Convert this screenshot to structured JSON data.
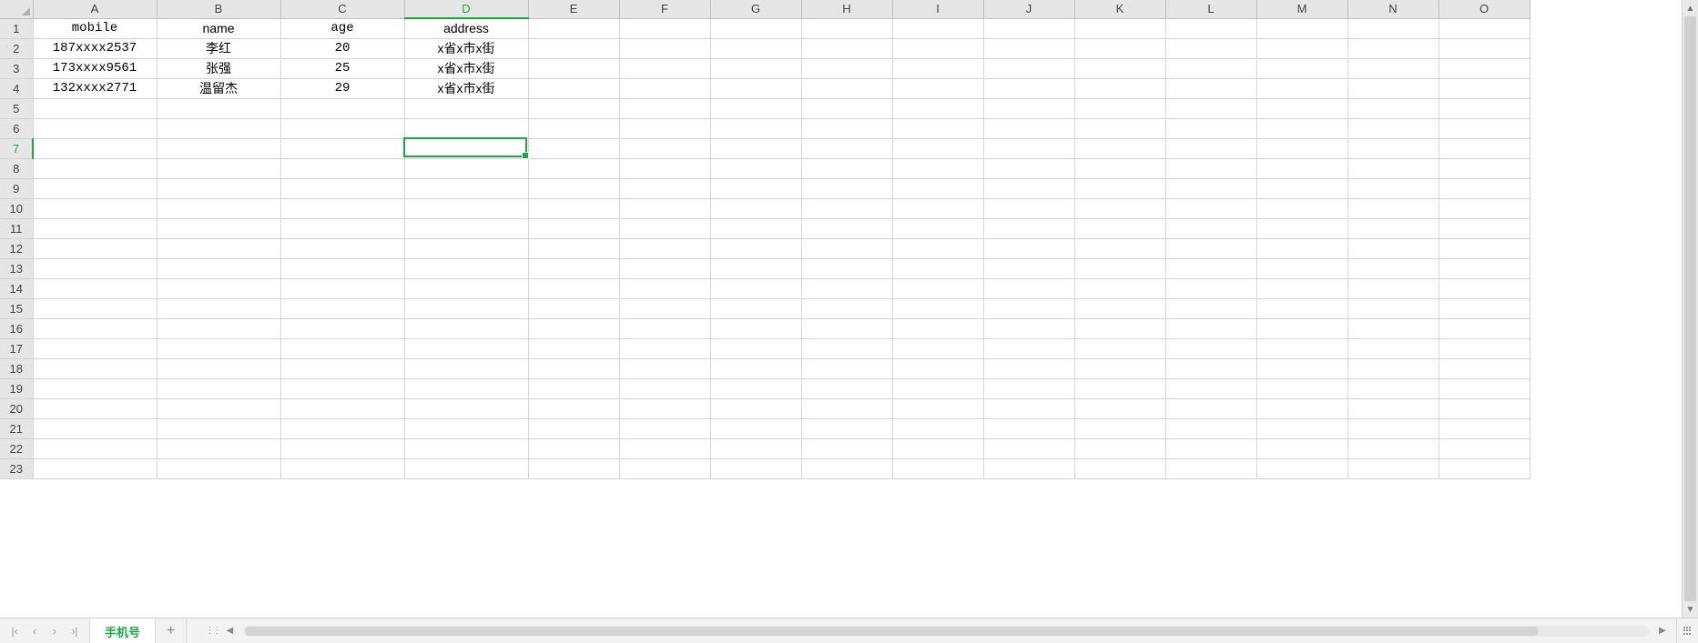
{
  "columns": [
    "A",
    "B",
    "C",
    "D",
    "E",
    "F",
    "G",
    "H",
    "I",
    "J",
    "K",
    "L",
    "M",
    "N",
    "O"
  ],
  "wide_columns": [
    "A",
    "B",
    "C",
    "D"
  ],
  "row_count": 23,
  "active_cell": {
    "col": "D",
    "row": 7
  },
  "headers": {
    "A": "mobile",
    "B": "name",
    "C": "age",
    "D": "address"
  },
  "rows": [
    {
      "A": "187xxxx2537",
      "B": "李红",
      "C": "20",
      "D": "x省x市x街"
    },
    {
      "A": "173xxxx9561",
      "B": "张强",
      "C": "25",
      "D": "x省x市x街"
    },
    {
      "A": "132xxxx2771",
      "B": "温留杰",
      "C": "29",
      "D": "x省x市x街"
    }
  ],
  "cjk_columns": [
    "B",
    "D"
  ],
  "sheet_tab": {
    "active": "手机号"
  },
  "icons": {
    "nav_first": "|‹",
    "nav_prev": "‹",
    "nav_next": "›",
    "nav_last": "›|",
    "add_tab": "+",
    "scroll_up": "▲",
    "scroll_down": "▼",
    "scroll_left": "◀",
    "scroll_right": "▶",
    "splitter": "⋮⋮"
  }
}
